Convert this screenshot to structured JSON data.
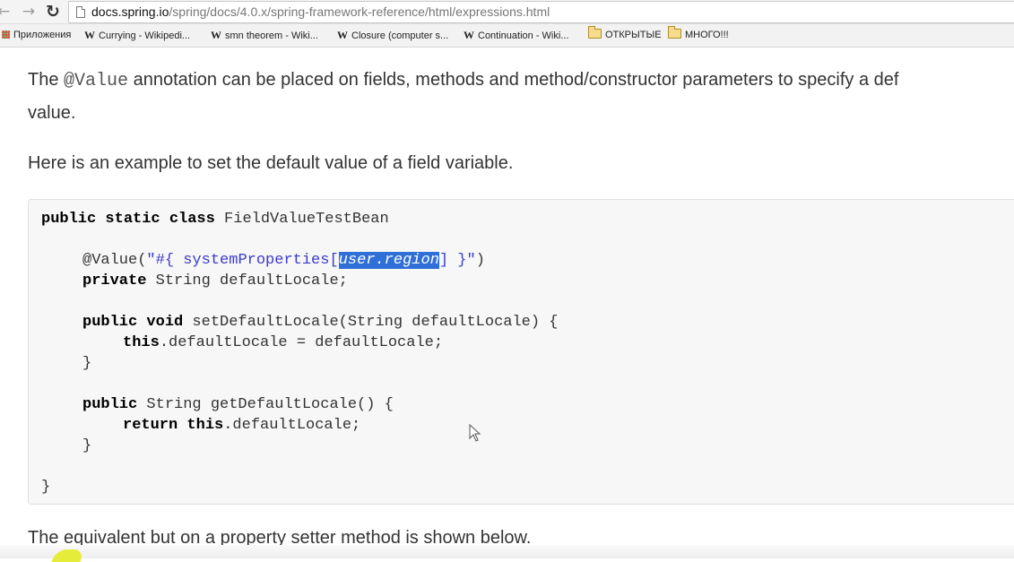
{
  "browser": {
    "url_host": "docs.spring.io",
    "url_path": "/spring/docs/4.0.x/spring-framework-reference/html/expressions.html",
    "nav": {
      "back_icon": "arrow-left-icon",
      "forward_icon": "arrow-right-icon",
      "reload_icon": "reload-icon"
    }
  },
  "bookmarks": {
    "items": [
      {
        "label": "Приложения",
        "icon": "apps-grid-icon"
      },
      {
        "label": "Currying - Wikipedi...",
        "icon": "wikipedia-icon"
      },
      {
        "label": "smn theorem - Wiki...",
        "icon": "wikipedia-icon"
      },
      {
        "label": "Closure (computer s...",
        "icon": "wikipedia-icon"
      },
      {
        "label": "Continuation - Wiki...",
        "icon": "wikipedia-icon"
      },
      {
        "label": "ОТКРЫТЫЕ",
        "icon": "folder-icon"
      },
      {
        "label": "МНОГО!!!",
        "icon": "folder-icon"
      }
    ]
  },
  "doc": {
    "para1_before": "The ",
    "para1_code": "@Value",
    "para1_after": " annotation can be placed on fields, methods and method/constructor parameters to specify a def",
    "para1_line2": "value.",
    "para2": "Here is an example to set the default value of a field variable.",
    "para3": "The equivalent but on a property setter method is shown below.",
    "code": {
      "l1_kw": "public static class",
      "l1_rest": " FieldValueTestBean",
      "l2_ann": "@Value(",
      "l2_str_a": "\"#{ systemProperties[",
      "l2_highlight": "user.region",
      "l2_str_b": "] }\"",
      "l2_close": ")",
      "l3_kw": "private",
      "l3_rest": " String defaultLocale;",
      "l4_kw": "public void",
      "l4_rest": " setDefaultLocale(String defaultLocale) {",
      "l5_kw": "this",
      "l5_rest": ".defaultLocale = defaultLocale;",
      "l6": "}",
      "l7_kw": "public",
      "l7_rest": " String getDefaultLocale() {",
      "l8_kw": "return this",
      "l8_rest": ".defaultLocale;",
      "l9": "}",
      "l10": "}"
    }
  }
}
